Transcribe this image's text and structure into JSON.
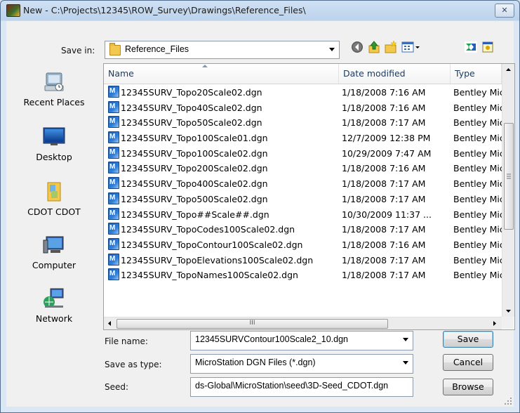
{
  "window": {
    "title": "New - C:\\Projects\\12345\\ROW_Survey\\Drawings\\Reference_Files\\",
    "close_glyph": "✕"
  },
  "save_in": {
    "label": "Save in:",
    "value": "Reference_Files"
  },
  "toolbar": {
    "icons": [
      "back-icon",
      "up-folder-icon",
      "new-folder-icon",
      "views-menu-icon",
      "microstation-icon",
      "window-icon"
    ]
  },
  "places": [
    {
      "label": "Recent Places",
      "icon": "recent-places-icon"
    },
    {
      "label": "Desktop",
      "icon": "desktop-icon"
    },
    {
      "label": "CDOT CDOT",
      "icon": "user-folder-icon"
    },
    {
      "label": "Computer",
      "icon": "computer-icon"
    },
    {
      "label": "Network",
      "icon": "network-icon"
    }
  ],
  "columns": {
    "name": "Name",
    "date": "Date modified",
    "type": "Type"
  },
  "files": [
    {
      "name": "12345SURV_Topo20Scale02.dgn",
      "date": "1/18/2008 7:16 AM",
      "type": "Bentley MicroStation Design"
    },
    {
      "name": "12345SURV_Topo40Scale02.dgn",
      "date": "1/18/2008 7:16 AM",
      "type": "Bentley MicroStation Design"
    },
    {
      "name": "12345SURV_Topo50Scale02.dgn",
      "date": "1/18/2008 7:17 AM",
      "type": "Bentley MicroStation Design"
    },
    {
      "name": "12345SURV_Topo100Scale01.dgn",
      "date": "12/7/2009 12:38 PM",
      "type": "Bentley MicroStation Design"
    },
    {
      "name": "12345SURV_Topo100Scale02.dgn",
      "date": "10/29/2009 7:47 AM",
      "type": "Bentley MicroStation Design"
    },
    {
      "name": "12345SURV_Topo200Scale02.dgn",
      "date": "1/18/2008 7:16 AM",
      "type": "Bentley MicroStation Design"
    },
    {
      "name": "12345SURV_Topo400Scale02.dgn",
      "date": "1/18/2008 7:17 AM",
      "type": "Bentley MicroStation Design"
    },
    {
      "name": "12345SURV_Topo500Scale02.dgn",
      "date": "1/18/2008 7:17 AM",
      "type": "Bentley MicroStation Design"
    },
    {
      "name": "12345SURV_Topo##Scale##.dgn",
      "date": "10/30/2009 11:37 ...",
      "type": "Bentley MicroStation Design"
    },
    {
      "name": "12345SURV_TopoCodes100Scale02.dgn",
      "date": "1/18/2008 7:17 AM",
      "type": "Bentley MicroStation Design"
    },
    {
      "name": "12345SURV_TopoContour100Scale02.dgn",
      "date": "1/18/2008 7:16 AM",
      "type": "Bentley MicroStation Design"
    },
    {
      "name": "12345SURV_TopoElevations100Scale02.dgn",
      "date": "1/18/2008 7:17 AM",
      "type": "Bentley MicroStation Design"
    },
    {
      "name": "12345SURV_TopoNames100Scale02.dgn",
      "date": "1/18/2008 7:17 AM",
      "type": "Bentley MicroStation Design"
    }
  ],
  "scrollbar": {
    "grip": "III"
  },
  "form": {
    "file_name_label": "File name:",
    "file_name_value": "12345SURVContour100Scale2_10.dgn",
    "save_type_label": "Save as type:",
    "save_type_value": "MicroStation DGN Files (*.dgn)",
    "seed_label": "Seed:",
    "seed_value": "ds-Global\\MicroStation\\seed\\3D-Seed_CDOT.dgn"
  },
  "buttons": {
    "save": "Save",
    "cancel": "Cancel",
    "browse": "Browse"
  }
}
